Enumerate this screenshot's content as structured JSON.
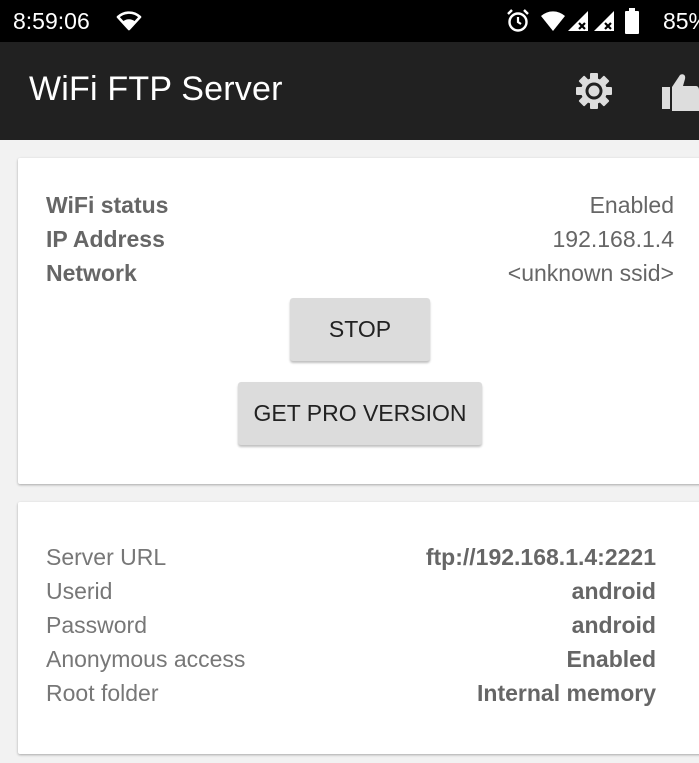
{
  "status_bar": {
    "time": "8:59:06",
    "battery_percent": "85%",
    "icons": [
      "wifi-icon",
      "alarm-icon",
      "wifi-signal-icon",
      "cell-signal-icon",
      "cell-signal-icon",
      "battery-icon"
    ]
  },
  "app_bar": {
    "title": "WiFi FTP Server",
    "actions": [
      "settings-gear-icon",
      "thumbs-up-icon"
    ]
  },
  "status_card": {
    "rows": [
      {
        "label": "WiFi status",
        "value": "Enabled"
      },
      {
        "label": "IP Address",
        "value": "192.168.1.4"
      },
      {
        "label": "Network",
        "value": "<unknown ssid>"
      }
    ],
    "stop_button": "STOP",
    "pro_button": "GET PRO VERSION"
  },
  "server_card": {
    "rows": [
      {
        "label": "Server URL",
        "value": "ftp://192.168.1.4:2221"
      },
      {
        "label": "Userid",
        "value": "android"
      },
      {
        "label": "Password",
        "value": "android"
      },
      {
        "label": "Anonymous access",
        "value": "Enabled"
      },
      {
        "label": "Root folder",
        "value": "Internal memory"
      }
    ]
  },
  "colors": {
    "status_bar_bg": "#000000",
    "app_bar_bg": "#212121",
    "page_bg": "#f2f2f2",
    "button_bg": "#dcdcdc"
  }
}
